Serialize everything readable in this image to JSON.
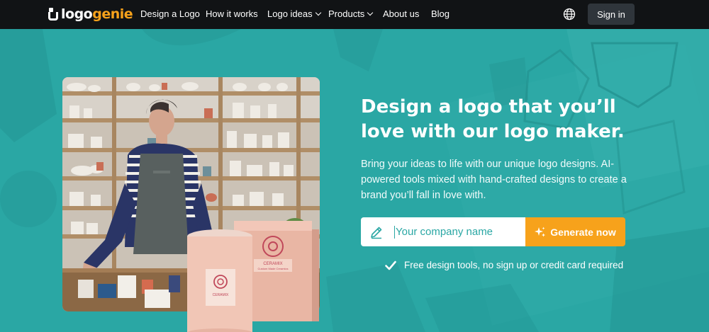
{
  "nav": {
    "logo": {
      "part1": "logo",
      "part2": "genie"
    },
    "links": [
      {
        "label": "Design a Logo",
        "dropdown": false
      },
      {
        "label": "How it works",
        "dropdown": false
      },
      {
        "label": "Logo ideas",
        "dropdown": true
      },
      {
        "label": "Products",
        "dropdown": true
      },
      {
        "label": "About us",
        "dropdown": false
      },
      {
        "label": "Blog",
        "dropdown": false
      }
    ],
    "language_icon": "globe-icon",
    "signin_label": "Sign in"
  },
  "hero": {
    "heading": "Design a logo that you’ll love with our logo maker.",
    "subtext": "Bring your ideas to life with our unique logo designs. AI-powered tools mixed with hand-crafted designs to create a brand you’ll fall in love with.",
    "input": {
      "placeholder": "Your company name",
      "value": ""
    },
    "generate_label": "Generate now",
    "note": "Free design tools, no sign up or credit card required",
    "product_label_1": "CERAMIX",
    "product_label_2": "Custom Made Ceramics"
  },
  "colors": {
    "nav_bg": "#111315",
    "hero_bg": "#2aa7a4",
    "accent": "#f7a21b",
    "signin_bg": "#2f353b"
  }
}
